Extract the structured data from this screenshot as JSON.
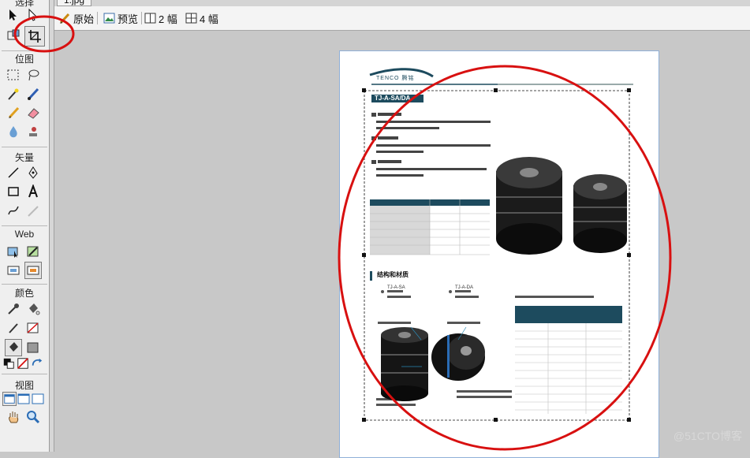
{
  "tool_sections": {
    "select": "选择",
    "bitmap": "位图",
    "vector": "矢量",
    "web": "Web",
    "colors": "颜色",
    "view": "视图"
  },
  "document_tab": "1.jpg",
  "view_buttons": {
    "original": "原始",
    "preview": "预览",
    "two_up": "2 幅",
    "four_up": "4 幅"
  },
  "page": {
    "brand": "TENCO 腾铭",
    "product_badge": "TJ-A-SA/DA",
    "section_heading": "结构和材质",
    "model_sa": "TJ-A-SA",
    "model_da": "TJ-A-DA"
  },
  "watermark": "@51CTO博客",
  "colors": {
    "accent_red": "#d81010",
    "teal": "#1d4b5e",
    "page_border": "#8fb0d8"
  }
}
